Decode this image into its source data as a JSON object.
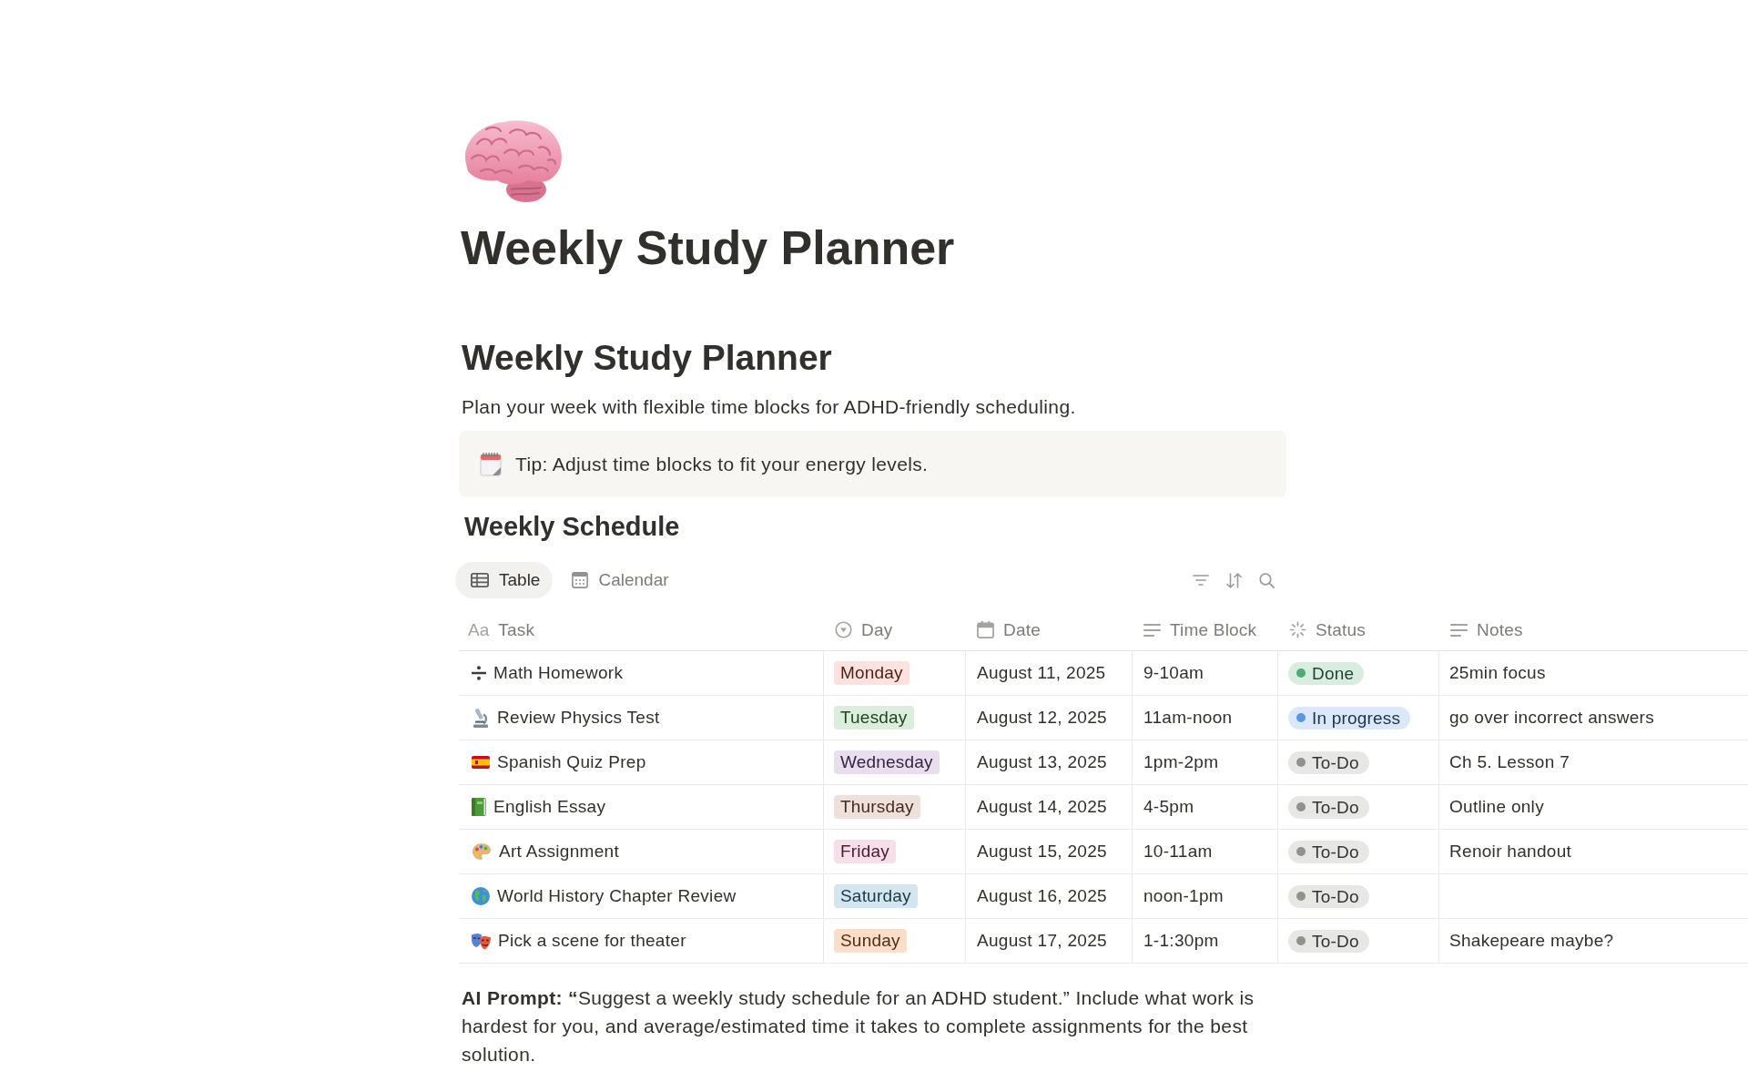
{
  "page": {
    "title": "Weekly Study Planner"
  },
  "heading": "Weekly Study Planner",
  "description": "Plan your week with flexible time blocks for ADHD-friendly scheduling.",
  "callout": {
    "text": "Tip: Adjust time blocks to fit your energy levels."
  },
  "database": {
    "title": "Weekly Schedule",
    "views": [
      {
        "label": "Table",
        "kind": "table",
        "selected": true
      },
      {
        "label": "Calendar",
        "kind": "calendar",
        "selected": false
      }
    ],
    "columns": [
      {
        "label": "Task",
        "kind": "title",
        "mark": "Aa"
      },
      {
        "label": "Day",
        "kind": "select"
      },
      {
        "label": "Date",
        "kind": "date"
      },
      {
        "label": "Time Block",
        "kind": "text"
      },
      {
        "label": "Status",
        "kind": "status"
      },
      {
        "label": "Notes",
        "kind": "text"
      }
    ],
    "rows": [
      {
        "task": "Math Homework",
        "kind": "divide",
        "day": {
          "label": "Monday",
          "color": "#ffe2dd"
        },
        "date": "August 11, 2025",
        "time_block": "9-10am",
        "status": {
          "label": "Done",
          "color": "#4dab74"
        },
        "notes": "25min focus"
      },
      {
        "task": "Review Physics Test",
        "kind": "microscope",
        "day": {
          "label": "Tuesday",
          "color": "#dbeddb"
        },
        "date": "August 12, 2025",
        "time_block": "11am-noon",
        "status": {
          "label": "In progress",
          "color": "#5a97e3"
        },
        "notes": "go over incorrect answers"
      },
      {
        "task": "Spanish Quiz Prep",
        "kind": "flag",
        "day": {
          "label": "Wednesday",
          "color": "#e8deee"
        },
        "date": "August 13, 2025",
        "time_block": "1pm-2pm",
        "status": {
          "label": "To-Do",
          "color": "#91918e"
        },
        "notes": "Ch 5. Lesson 7"
      },
      {
        "task": "English Essay",
        "kind": "book",
        "day": {
          "label": "Thursday",
          "color": "#eee0da"
        },
        "date": "August 14, 2025",
        "time_block": "4-5pm",
        "status": {
          "label": "To-Do",
          "color": "#91918e"
        },
        "notes": "Outline only"
      },
      {
        "task": "Art Assignment",
        "kind": "palette",
        "day": {
          "label": "Friday",
          "color": "#f5e0e9"
        },
        "date": "August 15, 2025",
        "time_block": "10-11am",
        "status": {
          "label": "To-Do",
          "color": "#91918e"
        },
        "notes": "Renoir handout"
      },
      {
        "task": "World History Chapter Review",
        "kind": "globe",
        "day": {
          "label": "Saturday",
          "color": "#d3e5ef"
        },
        "date": "August 16, 2025",
        "time_block": "noon-1pm",
        "status": {
          "label": "To-Do",
          "color": "#91918e"
        }
      },
      {
        "task": "Pick a scene for theater",
        "kind": "masks",
        "day": {
          "label": "Sunday",
          "color": "#fadec9"
        },
        "date": "August 17, 2025",
        "time_block": "1-1:30pm",
        "status": {
          "label": "To-Do",
          "color": "#91918e"
        },
        "notes": "Shakepeare maybe?"
      }
    ]
  },
  "ai_prompt": "**AI Prompt: “**Suggest a weekly study schedule for an ADHD student.” Include what work is hardest for you, and average/estimated time it takes to complete assignments for the best solution."
}
